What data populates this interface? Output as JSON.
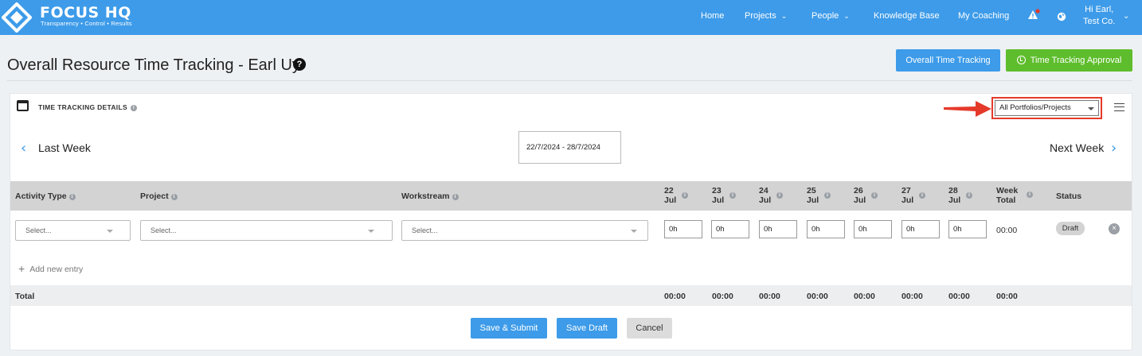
{
  "nav": {
    "logo_title": "FOCUS HQ",
    "logo_tagline": "Transparency • Control • Results",
    "home": "Home",
    "projects": "Projects",
    "people": "People",
    "knowledge_base": "Knowledge Base",
    "my_coaching": "My Coaching",
    "greeting_line1": "Hi Earl,",
    "greeting_line2": "Test Co."
  },
  "header": {
    "title": "Overall Resource Time Tracking - Earl Uy",
    "overall_button": "Overall Time Tracking",
    "approval_button": "Time Tracking Approval"
  },
  "card": {
    "details_label": "TIME TRACKING DETAILS",
    "portfolio_filter": "All Portfolios/Projects",
    "prev_label": "Last Week",
    "next_label": "Next Week",
    "date_range": "22/7/2024 - 28/7/2024"
  },
  "table": {
    "headers": {
      "activity_type": "Activity Type",
      "project": "Project",
      "workstream": "Workstream",
      "week_total_1": "Week",
      "week_total_2": "Total",
      "status": "Status"
    },
    "days": [
      {
        "day": "22",
        "month": "Jul"
      },
      {
        "day": "23",
        "month": "Jul"
      },
      {
        "day": "24",
        "month": "Jul"
      },
      {
        "day": "25",
        "month": "Jul"
      },
      {
        "day": "26",
        "month": "Jul"
      },
      {
        "day": "27",
        "month": "Jul"
      },
      {
        "day": "28",
        "month": "Jul"
      }
    ],
    "row": {
      "activity_placeholder": "Select...",
      "project_placeholder": "Select...",
      "workstream_placeholder": "Select...",
      "hours": [
        "0h",
        "0h",
        "0h",
        "0h",
        "0h",
        "0h",
        "0h"
      ],
      "week_total": "00:00",
      "status": "Draft"
    },
    "add_entry": "Add new entry",
    "footer": {
      "label": "Total",
      "day_totals": [
        "00:00",
        "00:00",
        "00:00",
        "00:00",
        "00:00",
        "00:00",
        "00:00"
      ],
      "week_total": "00:00"
    }
  },
  "actions": {
    "submit": "Save & Submit",
    "draft": "Save Draft",
    "cancel": "Cancel"
  },
  "colors": {
    "brand_blue": "#3d9be9",
    "approval_green": "#5ebd2c",
    "highlight_red": "#e53a2a"
  }
}
